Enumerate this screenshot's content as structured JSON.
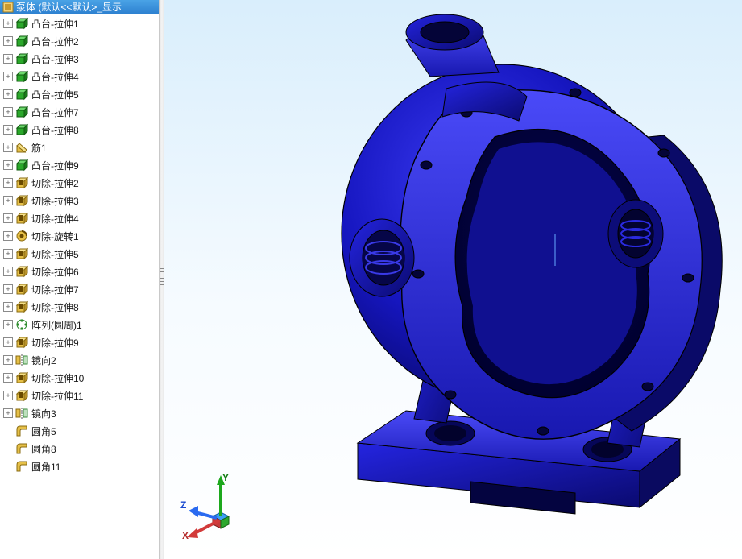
{
  "header": {
    "title": "泵体  (默认<<默认>_显示"
  },
  "tree": {
    "items": [
      {
        "label": "凸台-拉伸1",
        "icon": "extrude-boss",
        "expand": "+"
      },
      {
        "label": "凸台-拉伸2",
        "icon": "extrude-boss",
        "expand": "+"
      },
      {
        "label": "凸台-拉伸3",
        "icon": "extrude-boss",
        "expand": "+"
      },
      {
        "label": "凸台-拉伸4",
        "icon": "extrude-boss",
        "expand": "+"
      },
      {
        "label": "凸台-拉伸5",
        "icon": "extrude-boss",
        "expand": "+"
      },
      {
        "label": "凸台-拉伸7",
        "icon": "extrude-boss",
        "expand": "+"
      },
      {
        "label": "凸台-拉伸8",
        "icon": "extrude-boss",
        "expand": "+"
      },
      {
        "label": "筋1",
        "icon": "rib",
        "expand": "+"
      },
      {
        "label": "凸台-拉伸9",
        "icon": "extrude-boss",
        "expand": "+"
      },
      {
        "label": "切除-拉伸2",
        "icon": "extrude-cut",
        "expand": "+"
      },
      {
        "label": "切除-拉伸3",
        "icon": "extrude-cut",
        "expand": "+"
      },
      {
        "label": "切除-拉伸4",
        "icon": "extrude-cut",
        "expand": "+"
      },
      {
        "label": "切除-旋转1",
        "icon": "revolve-cut",
        "expand": "+"
      },
      {
        "label": "切除-拉伸5",
        "icon": "extrude-cut",
        "expand": "+"
      },
      {
        "label": "切除-拉伸6",
        "icon": "extrude-cut",
        "expand": "+"
      },
      {
        "label": "切除-拉伸7",
        "icon": "extrude-cut",
        "expand": "+"
      },
      {
        "label": "切除-拉伸8",
        "icon": "extrude-cut",
        "expand": "+"
      },
      {
        "label": "阵列(圆周)1",
        "icon": "circular-pattern",
        "expand": "+"
      },
      {
        "label": "切除-拉伸9",
        "icon": "extrude-cut",
        "expand": "+"
      },
      {
        "label": "镜向2",
        "icon": "mirror",
        "expand": "+"
      },
      {
        "label": "切除-拉伸10",
        "icon": "extrude-cut",
        "expand": "+"
      },
      {
        "label": "切除-拉伸11",
        "icon": "extrude-cut",
        "expand": "+"
      },
      {
        "label": "镜向3",
        "icon": "mirror",
        "expand": "+"
      },
      {
        "label": "圆角5",
        "icon": "fillet",
        "expand": ""
      },
      {
        "label": "圆角8",
        "icon": "fillet",
        "expand": ""
      },
      {
        "label": "圆角11",
        "icon": "fillet",
        "expand": ""
      }
    ]
  },
  "triad": {
    "x": "X",
    "y": "Y",
    "z": "Z"
  },
  "colors": {
    "model_fill": "#1a1ac8",
    "model_dark": "#0a0a6a",
    "model_light": "#4a4af0",
    "edge": "#000000"
  }
}
